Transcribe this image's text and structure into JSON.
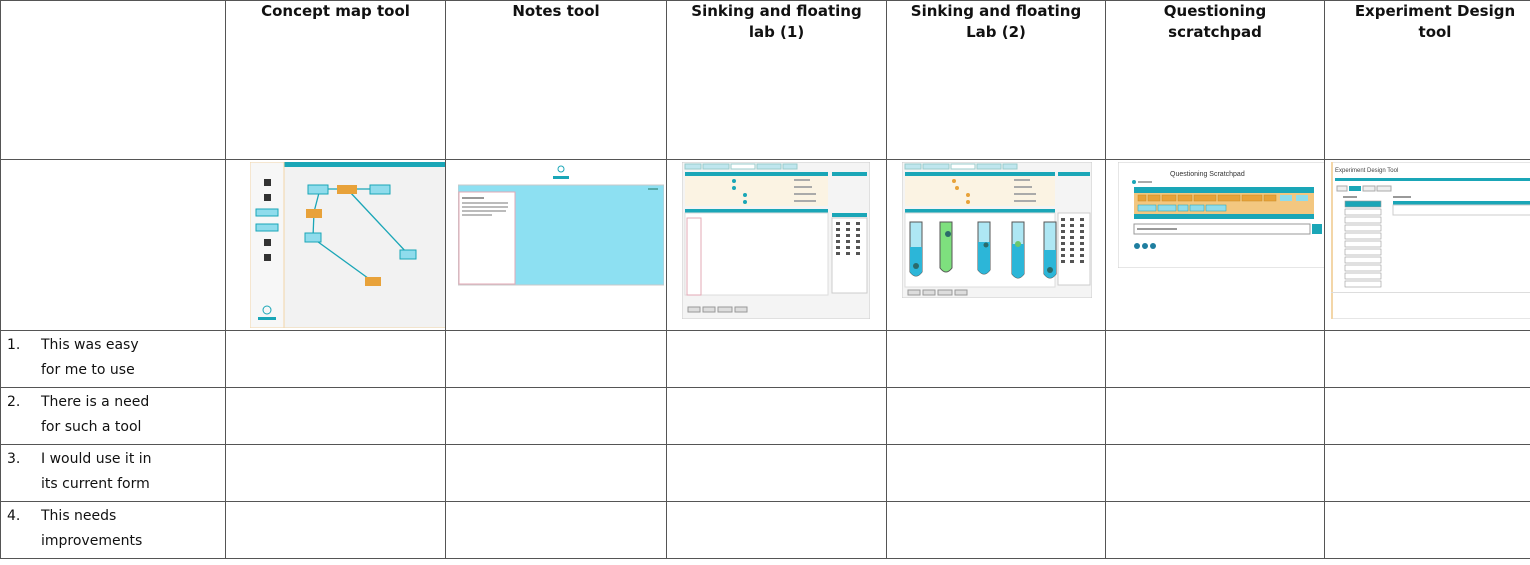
{
  "table": {
    "columns": [
      {
        "label": "",
        "lines": []
      },
      {
        "label": "Concept map tool",
        "lines": [
          "Concept  map tool"
        ]
      },
      {
        "label": "Notes tool",
        "lines": [
          "Notes tool"
        ]
      },
      {
        "label": "Sinking and floating lab (1)",
        "lines": [
          "Sinking and floating",
          "lab (1)"
        ]
      },
      {
        "label": "Sinking and floating Lab (2)",
        "lines": [
          "Sinking and floating",
          "Lab (2)"
        ]
      },
      {
        "label": "Questioning scratchpad",
        "lines": [
          "Questioning",
          "scratchpad"
        ]
      },
      {
        "label": "Experiment Design tool",
        "lines": [
          "Experiment Design",
          "tool"
        ]
      }
    ],
    "questions": [
      {
        "num": "1.",
        "lines": [
          "This was easy",
          "for me to use"
        ]
      },
      {
        "num": "2.",
        "lines": [
          "There is a need",
          "for such a tool"
        ]
      },
      {
        "num": "3.",
        "lines": [
          "I would use it in",
          "its current form"
        ]
      },
      {
        "num": "4.",
        "lines": [
          "This needs",
          "improvements"
        ]
      }
    ]
  },
  "thumbnails": {
    "questioning_title": "Questioning Scratchpad",
    "design_title": "Experiment Design Tool",
    "accent": "#1aa6b7",
    "accent_light": "#8fdcec",
    "orange": "#e8a23a",
    "green": "#7ee07e"
  }
}
